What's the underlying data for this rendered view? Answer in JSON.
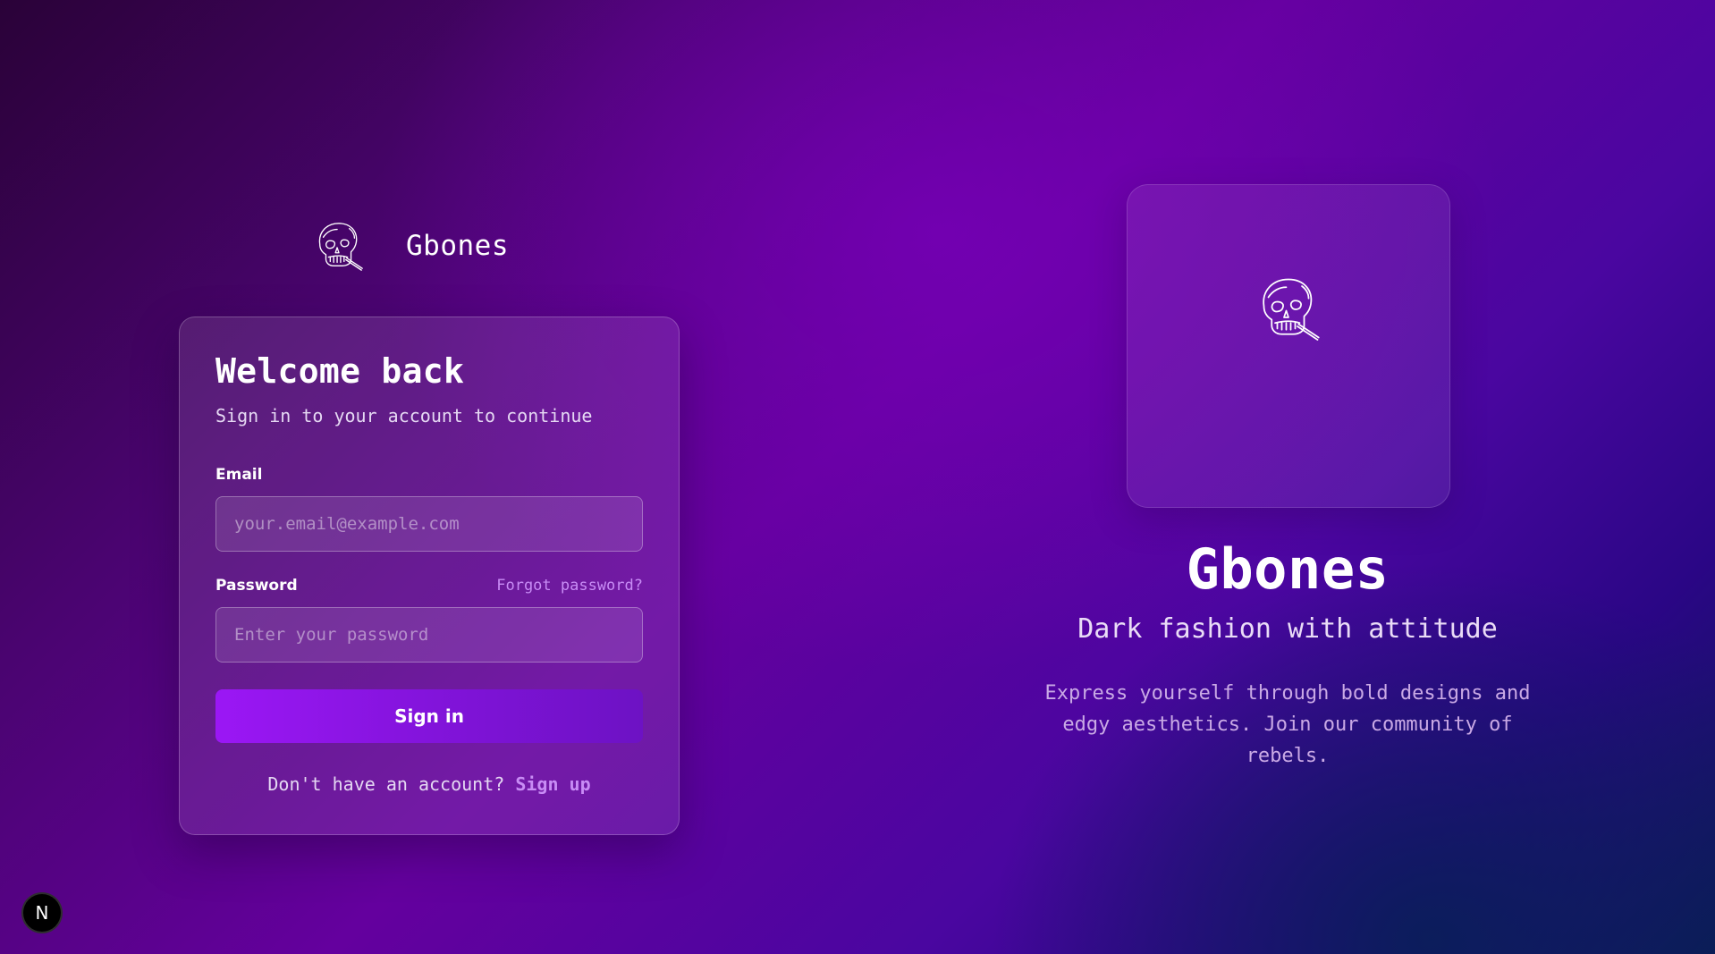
{
  "brand": {
    "name": "Gbones",
    "logo_icon": "skull-icon"
  },
  "login_card": {
    "title": "Welcome back",
    "subtitle": "Sign in to your account to continue",
    "email": {
      "label": "Email",
      "value": "",
      "placeholder": "your.email@example.com"
    },
    "password": {
      "label": "Password",
      "value": "",
      "placeholder": "Enter your password",
      "forgot_link": "Forgot password?"
    },
    "submit_label": "Sign in",
    "signup_prompt": "Don't have an account?",
    "signup_link": "Sign up"
  },
  "hero": {
    "logo_icon": "skull-icon",
    "title": "Gbones",
    "tagline": "Dark fashion with attitude",
    "description": "Express yourself through bold designs and edgy aesthetics. Join our community of rebels."
  },
  "badge": {
    "label": "N"
  },
  "colors": {
    "accent": "#9b17f5",
    "link": "#c88cf5",
    "background_mid": "#64009e",
    "background_dark": "#2a0238",
    "background_corner": "#0a1d55"
  }
}
